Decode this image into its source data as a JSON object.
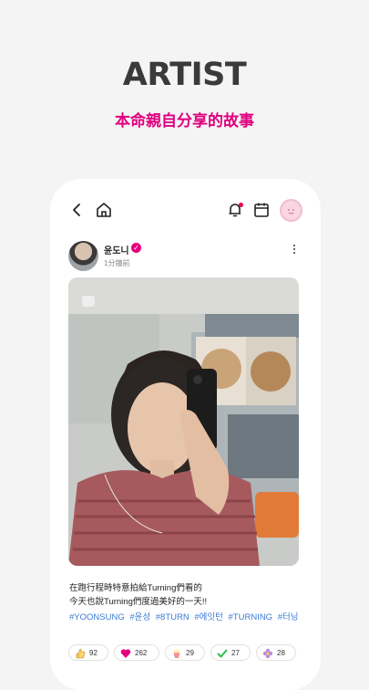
{
  "promo": {
    "title": "ARTIST",
    "subtitle": "本命親自分享的故事"
  },
  "topbar": {
    "back_icon": "back-arrow-icon",
    "home_icon": "home-icon",
    "bell_icon": "bell-icon",
    "calendar_icon": "calendar-icon",
    "profile_icon": "profile-avatar"
  },
  "post": {
    "author": "윤도니",
    "time": "1分鐘前",
    "caption_line1": "在跑行程時特意拍給Turning們看的",
    "caption_line2": "今天也說Turning們度過美好的一天!!",
    "hashtags": [
      "#YOONSUNG",
      "#윤성",
      "#8TURN",
      "#에잇턴",
      "#TURNING",
      "#터닝"
    ],
    "reactions": [
      {
        "icon": "thumbs-up-icon",
        "count": "92"
      },
      {
        "icon": "heart-icon",
        "count": "262"
      },
      {
        "icon": "popcorn-icon",
        "count": "29"
      },
      {
        "icon": "check-icon",
        "count": "27"
      },
      {
        "icon": "flower-icon",
        "count": "28"
      }
    ]
  },
  "colors": {
    "accent": "#e0007f",
    "hashtag": "#3a7bd5",
    "heart": "#e5007f"
  }
}
